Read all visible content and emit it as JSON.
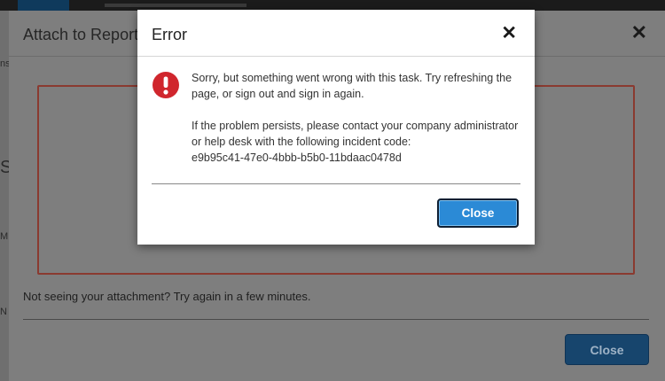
{
  "background": {
    "left_strip_marks": [
      "ns",
      "S",
      "M",
      "N"
    ]
  },
  "attach_dialog": {
    "title": "Attach to Report",
    "close_icon": "close-icon",
    "note": "Not seeing your attachment? Try again in a few minutes.",
    "close_button_label": "Close"
  },
  "error_modal": {
    "title": "Error",
    "close_icon": "close-icon",
    "status_icon": "error-exclamation-icon",
    "message_line1": "Sorry, but something went wrong with this task. Try refreshing the page, or sign out and sign in again.",
    "message_line2": "If the problem persists, please contact your company administrator or help desk with the following incident code:",
    "incident_code": "e9b95c41-47e0-4bbb-b5b0-11bdaac0478d",
    "close_button_label": "Close"
  },
  "colors": {
    "accent_blue": "#2b8ad6",
    "error_red": "#d0262d",
    "drop_zone_border": "#8a3a30"
  }
}
